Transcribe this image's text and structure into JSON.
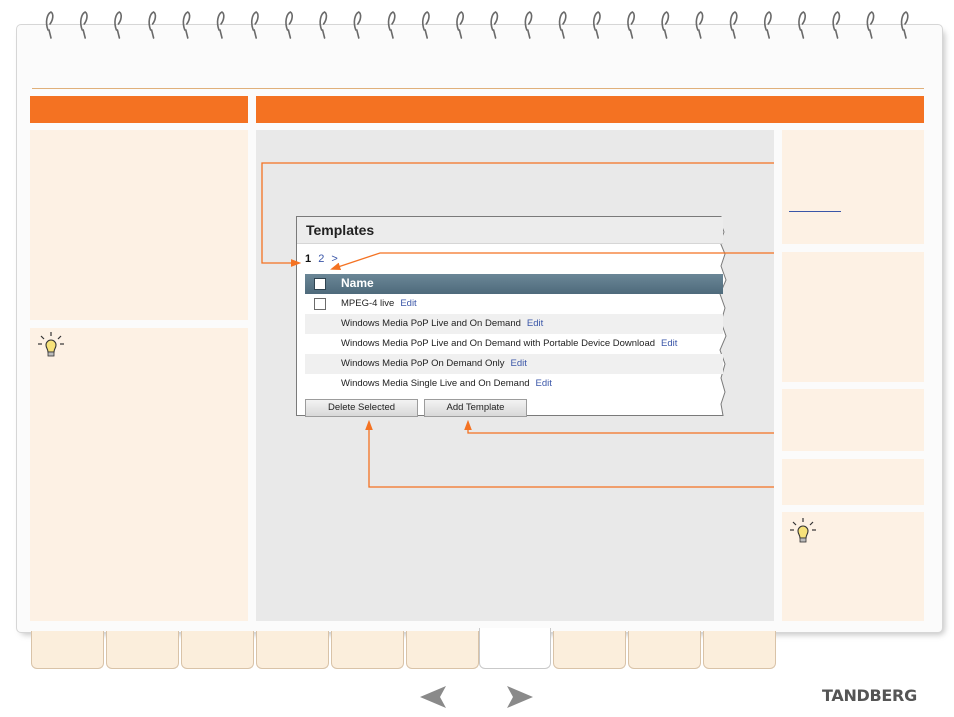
{
  "screenshot": {
    "title": "Templates",
    "pager": {
      "current": "1",
      "next_page": "2",
      "next_arrow": ">"
    },
    "table": {
      "header": "Name",
      "rows": [
        {
          "name": "MPEG-4 live",
          "edit": "Edit",
          "has_checkbox": true
        },
        {
          "name": "Windows Media PoP Live and On Demand",
          "edit": "Edit",
          "has_checkbox": false
        },
        {
          "name": "Windows Media PoP Live and On Demand with Portable Device Download",
          "edit": "Edit",
          "has_checkbox": false
        },
        {
          "name": "Windows Media PoP On Demand Only",
          "edit": "Edit",
          "has_checkbox": false
        },
        {
          "name": "Windows Media Single Live and On Demand",
          "edit": "Edit",
          "has_checkbox": false
        }
      ]
    },
    "buttons": {
      "delete_label": "Delete Selected",
      "add_label": "Add Template"
    }
  },
  "footer": {
    "logo": "TANDBERG"
  },
  "colors": {
    "accent": "#f47222",
    "panel": "#fdf1e4",
    "link": "#3a56a8"
  }
}
